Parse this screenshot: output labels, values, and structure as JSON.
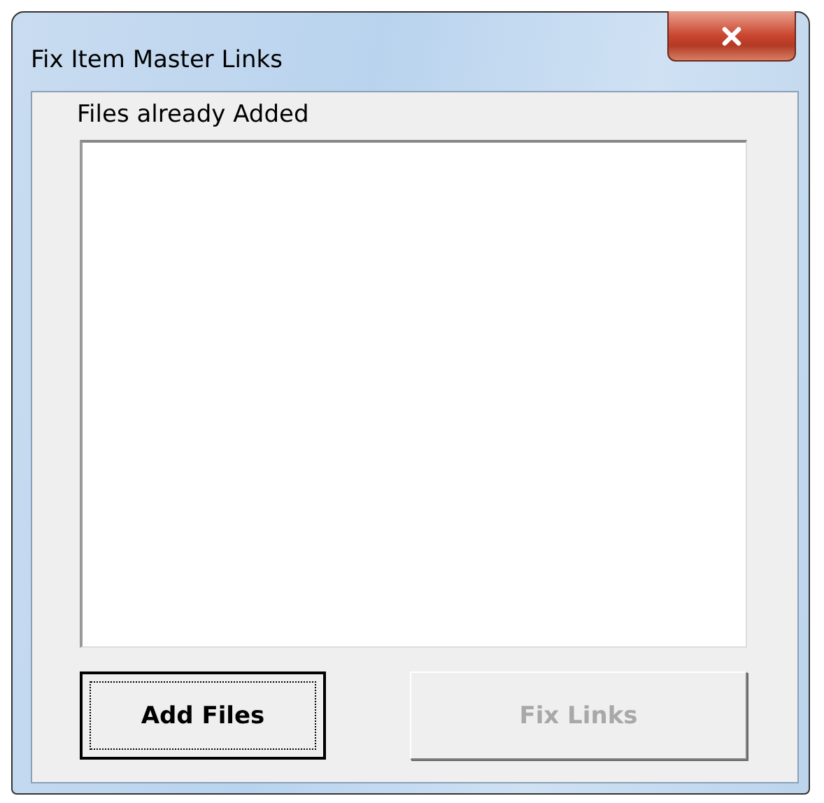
{
  "window": {
    "title": "Fix Item Master Links"
  },
  "list": {
    "label": "Files already Added"
  },
  "buttons": [
    {
      "label": "Add Files",
      "disabled": false,
      "focused": true
    },
    {
      "label": "Fix Links",
      "disabled": true,
      "focused": false
    }
  ]
}
